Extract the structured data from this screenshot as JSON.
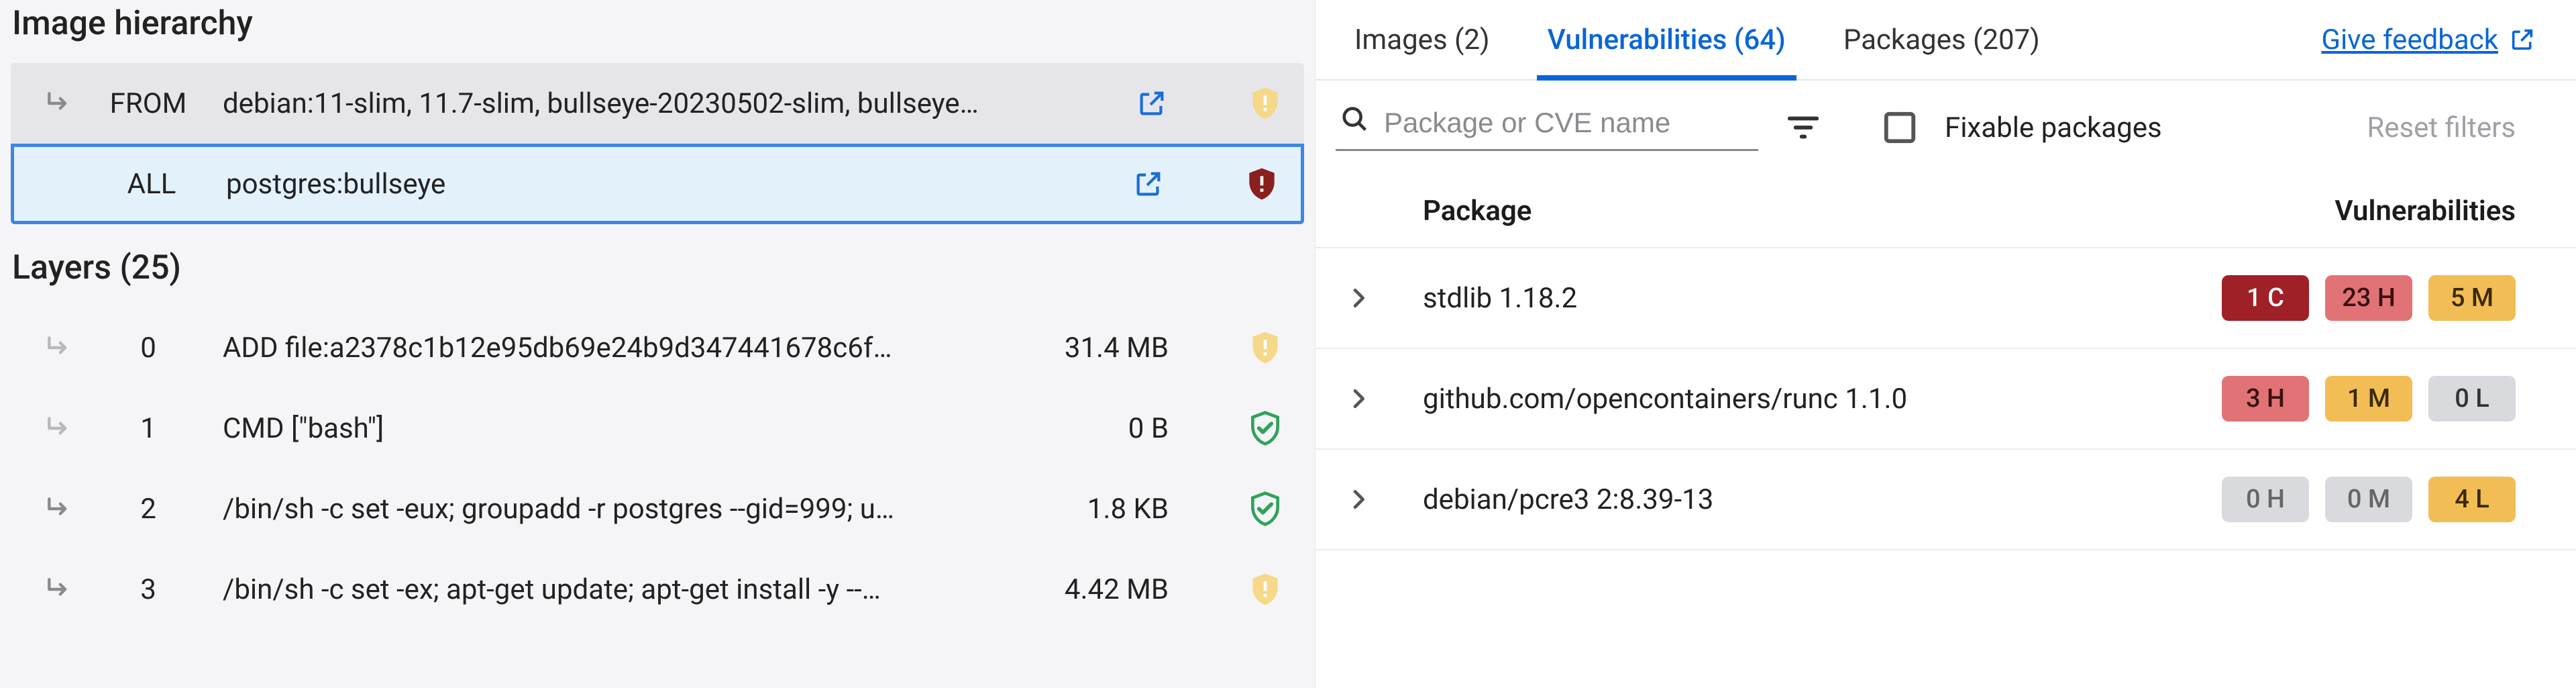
{
  "hierarchy": {
    "title": "Image hierarchy",
    "rows": [
      {
        "tag": "FROM",
        "cmd": "debian:11-slim, 11.7-slim, bullseye-20230502-slim, bullseye…",
        "status": "shield-warn-faded"
      },
      {
        "tag": "ALL",
        "cmd": "postgres:bullseye",
        "status": "shield-alert"
      }
    ]
  },
  "layers": {
    "title": "Layers (25)",
    "rows": [
      {
        "idx": "0",
        "cmd": "ADD file:a2378c1b12e95db69e24b9d347441678c6f…",
        "size": "31.4 MB",
        "status": "shield-warn-faded"
      },
      {
        "idx": "1",
        "cmd": "CMD [\"bash\"]",
        "size": "0 B",
        "status": "shield-ok"
      },
      {
        "idx": "2",
        "cmd": "/bin/sh -c set -eux; groupadd -r postgres --gid=999; u…",
        "size": "1.8 KB",
        "status": "shield-ok"
      },
      {
        "idx": "3",
        "cmd": "/bin/sh -c set -ex; apt-get update; apt-get install -y --…",
        "size": "4.42 MB",
        "status": "shield-warn-faded"
      }
    ]
  },
  "tabs": {
    "images": "Images (2)",
    "vulnerabilities": "Vulnerabilities (64)",
    "packages": "Packages (207)"
  },
  "feedback": "Give feedback",
  "filter": {
    "placeholder": "Package or CVE name",
    "fixable": "Fixable packages",
    "reset": "Reset filters"
  },
  "columns": {
    "package": "Package",
    "vulnerabilities": "Vulnerabilities"
  },
  "packages": [
    {
      "name": "stdlib 1.18.2",
      "badges": [
        {
          "label": "1 C",
          "cls": "sev-C"
        },
        {
          "label": "23 H",
          "cls": "sev-H"
        },
        {
          "label": "5 M",
          "cls": "sev-M"
        }
      ]
    },
    {
      "name": "github.com/opencontainers/runc 1.1.0",
      "badges": [
        {
          "label": "3 H",
          "cls": "sev-H"
        },
        {
          "label": "1 M",
          "cls": "sev-M"
        },
        {
          "label": "0 L",
          "cls": "sev-L"
        }
      ]
    },
    {
      "name": "debian/pcre3 2:8.39-13",
      "badges": [
        {
          "label": "0 H",
          "cls": "sev-H0"
        },
        {
          "label": "0 M",
          "cls": "sev-M0"
        },
        {
          "label": "4 L",
          "cls": "sev-M"
        }
      ]
    }
  ]
}
